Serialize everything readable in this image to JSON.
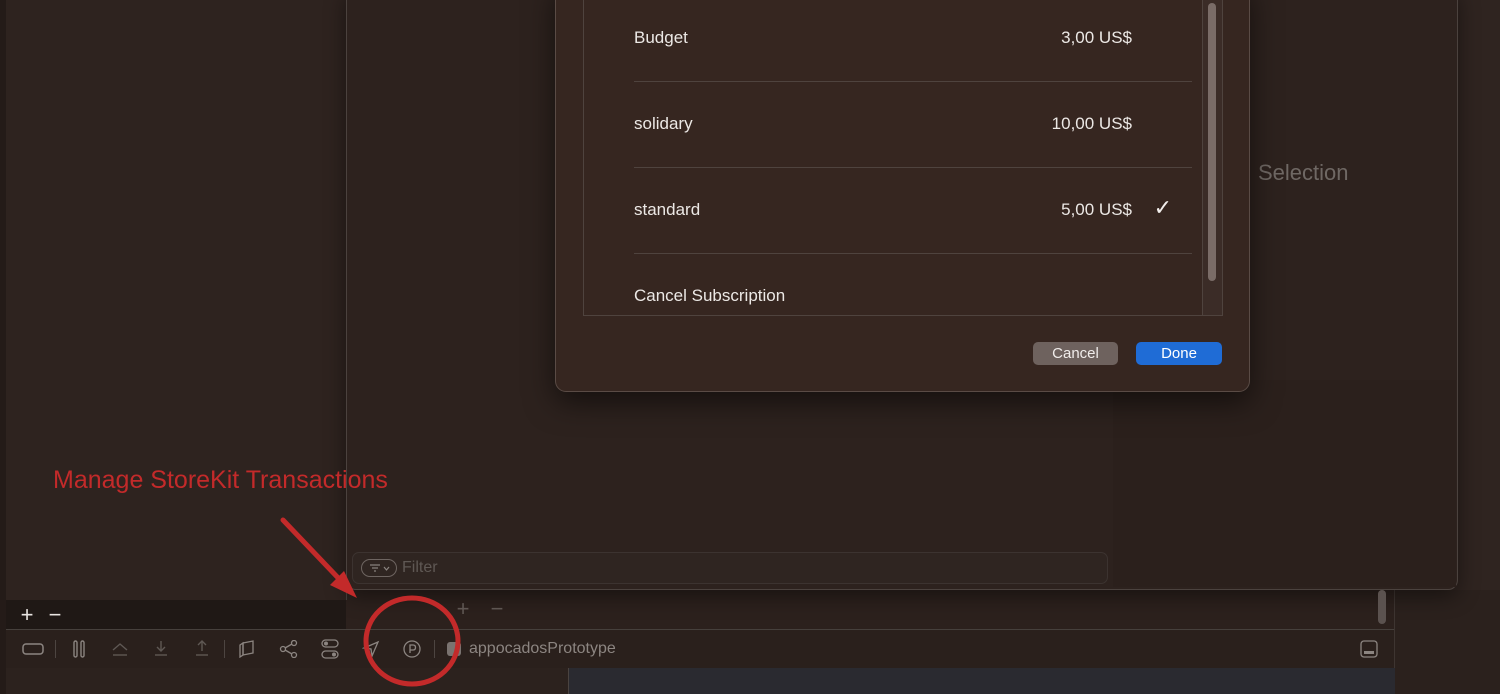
{
  "background": {
    "selection_label": "Selection",
    "filter_placeholder": "Filter",
    "app_name": "appocados­Prototype"
  },
  "sheet": {
    "rows": [
      {
        "name": "Budget",
        "price": "3,00 US$",
        "selected": false
      },
      {
        "name": "solidary",
        "price": "10,00 US$",
        "selected": false
      },
      {
        "name": "standard",
        "price": "5,00 US$",
        "selected": true
      },
      {
        "name": "Cancel Subscription",
        "price": "",
        "selected": false
      }
    ],
    "checkmark": "✓",
    "cancel_label": "Cancel",
    "done_label": "Done"
  },
  "annotation": {
    "text": "Manage StoreKit Transactions",
    "color": "#c32a2a"
  },
  "colors": {
    "done_button": "#1f6cd6",
    "background": "#2c211d"
  }
}
